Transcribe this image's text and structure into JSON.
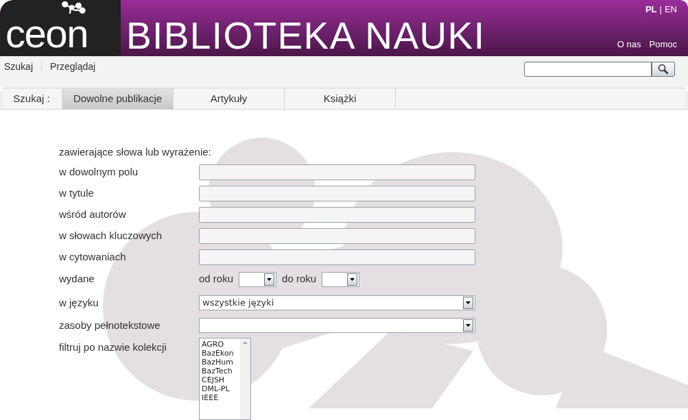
{
  "header": {
    "logo": "ceon",
    "title": "BIBLIOTEKA NAUKI",
    "language_separator": "|",
    "languages": [
      {
        "label": "PL",
        "selected": true
      },
      {
        "label": "EN",
        "selected": false
      }
    ],
    "links": [
      "O nas",
      "Pomoc"
    ]
  },
  "nav": {
    "items": [
      "Szukaj",
      "Przeglądaj"
    ]
  },
  "tabs": {
    "label": "Szukaj :",
    "items": [
      {
        "label": "Dowolne publikacje",
        "selected": true
      },
      {
        "label": "Artykuły",
        "selected": false
      },
      {
        "label": "Książki",
        "selected": false
      }
    ]
  },
  "form": {
    "heading": "zawierające słowa lub wyrażenie:",
    "text_fields": [
      "w dowolnym polu",
      "w tytule",
      "wśród autorów",
      "w słowach kluczowych",
      "w cytowaniach"
    ],
    "published": {
      "label": "wydane",
      "from": "od roku",
      "to": "do roku"
    },
    "language": {
      "label": "w języku",
      "value": "wszystkie języki"
    },
    "fulltext": {
      "label": "zasoby pełnotekstowe"
    },
    "collections": {
      "label": "filtruj po nazwie kolekcji",
      "options": [
        "AGRO",
        "BazEkon",
        "BazHum",
        "BazTech",
        "CEJSH",
        "DML-PL",
        "IEEE"
      ]
    }
  }
}
